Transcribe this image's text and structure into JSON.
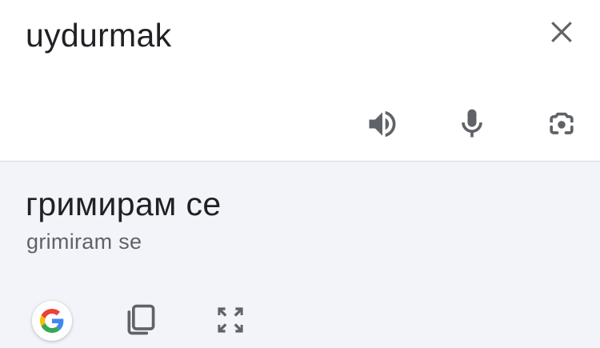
{
  "source": {
    "text": "uydurmak",
    "actions": [
      "speaker-icon",
      "microphone-icon",
      "camera-lens-icon"
    ],
    "close_icon": "close-icon"
  },
  "result": {
    "text": "гримирам се",
    "transliteration": "grimiram se",
    "actions": [
      "google-logo-icon",
      "copy-icon",
      "fullscreen-icon"
    ]
  },
  "colors": {
    "text_primary": "#202124",
    "text_secondary": "#5f6368",
    "icon_gray": "#5f6368",
    "result_background": "#f3f4f9",
    "divider": "#d5d7e0",
    "google_blue": "#4285F4",
    "google_red": "#EA4335",
    "google_yellow": "#FBBC05",
    "google_green": "#34A853"
  }
}
